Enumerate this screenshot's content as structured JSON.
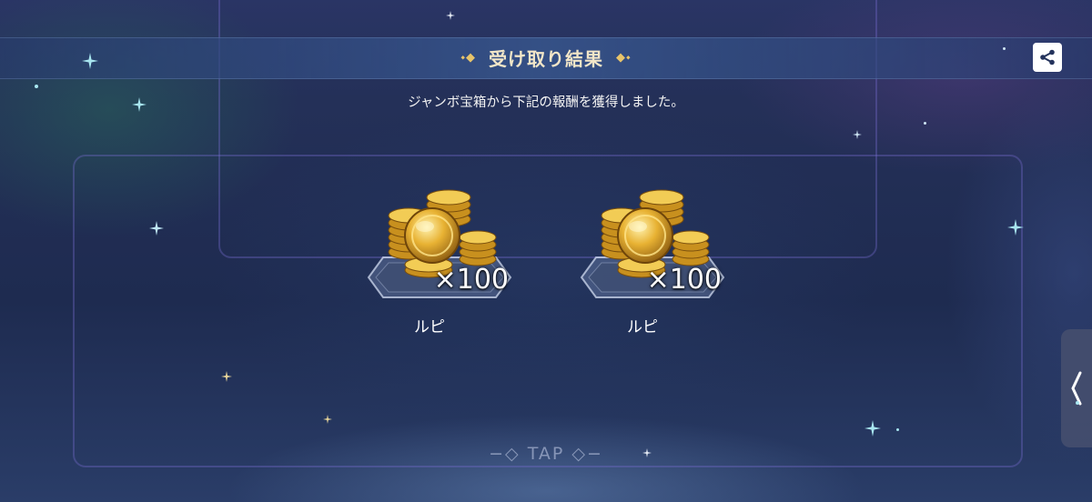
{
  "header": {
    "title": "受け取り結果",
    "ornament_left": "⬩◆",
    "ornament_right": "◆⬩"
  },
  "share_button": {
    "icon": "share-icon"
  },
  "message": "ジャンボ宝箱から下記の報酬を獲得しました。",
  "rewards": [
    {
      "icon": "coin-stack-icon",
      "quantity": "×100",
      "name": "ルピ"
    },
    {
      "icon": "coin-stack-icon",
      "quantity": "×100",
      "name": "ルピ"
    }
  ],
  "tap_prompt": "TAP",
  "side_tab": {
    "icon": "chevron-left-icon"
  },
  "colors": {
    "accent_gold": "#e8c46a",
    "title_text": "#f2e6c8",
    "background": "#1d2a4d"
  }
}
